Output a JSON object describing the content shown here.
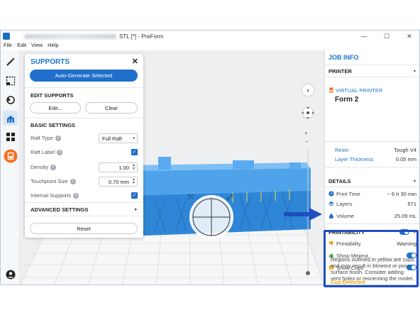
{
  "window": {
    "title": "STL [*] - PreForm",
    "minimize": "—",
    "maximize": "☐",
    "close": "✕"
  },
  "menu": [
    "File",
    "Edit",
    "View",
    "Help"
  ],
  "supports": {
    "title": "SUPPORTS",
    "close": "✕",
    "auto_generate": "Auto-Generate Selected",
    "edit_title": "EDIT SUPPORTS",
    "edit_btn": "Edit...",
    "clear_btn": "Clear",
    "basic_title": "BASIC SETTINGS",
    "raft_type_label": "Raft Type",
    "raft_type_value": "Full Raft",
    "raft_label_label": "Raft Label",
    "density_label": "Density",
    "density_value": "1.00",
    "touchpoint_label": "Touchpoint Size",
    "touchpoint_value": "0.70 mm",
    "internal_label": "Internal Supports",
    "advanced_title": "ADVANCED SETTINGS",
    "reset_btn": "Reset"
  },
  "job": {
    "title": "JOB INFO",
    "printer_head": "PRINTER",
    "virtual_printer": "VIRTUAL PRINTER",
    "printer_name": "Form 2",
    "resin_label": "Resin",
    "resin_value": "Tough V4",
    "layer_label": "Layer Thickness",
    "layer_value": "0.05 mm",
    "details_head": "DETAILS",
    "print_time_label": "Print Time",
    "print_time_value": "~ 6 h 30 min",
    "layers_label": "Layers",
    "layers_value": "571",
    "volume_label": "Volume",
    "volume_value": "25.09 mL",
    "printability_head": "PRINTABILITY",
    "printability_label": "Printability",
    "printability_value": "Warning",
    "show_minima": "Show Minima",
    "show_cups": "Show Cups",
    "cup_title": "Cup Detected",
    "cup_text": "Regions outlined in yellow are cups and may result in blowout or poor surface finish. Consider adding vent holes or reorienting the model."
  },
  "colors": {
    "accent": "#1f6fcb",
    "highlight": "#1e4ec0",
    "cup_title": "#e8a000",
    "model": "#3c95e0"
  }
}
